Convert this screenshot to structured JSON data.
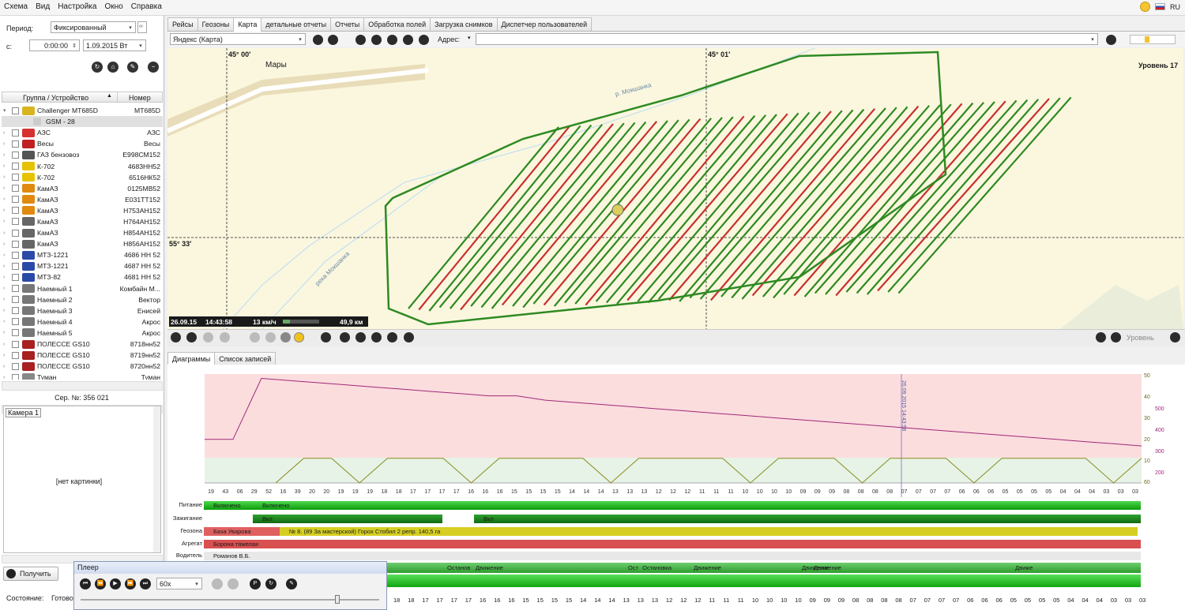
{
  "menu": {
    "items": [
      "Схема",
      "Вид",
      "Настройка",
      "Окно",
      "Справка"
    ],
    "lang": "RU"
  },
  "left": {
    "period_label": "Период:",
    "period_value": "Фиксированный",
    "from_label": "с:",
    "time_value": "0:00:00",
    "date_value": "1.09.2015 Вт",
    "col_group": "Группа / Устройство",
    "col_number": "Номер",
    "devices": [
      {
        "name": "Challenger MT685D",
        "num": "MT685D",
        "color": "#d8b520",
        "expanded": true
      },
      {
        "name": "GSM - 28",
        "num": "",
        "sub": true
      },
      {
        "name": "АЗС",
        "num": "АЗС",
        "color": "#d63030"
      },
      {
        "name": "Весы",
        "num": "Весы",
        "color": "#c02020"
      },
      {
        "name": "ГАЗ бензовоз",
        "num": "Е998СМ152",
        "color": "#555"
      },
      {
        "name": "К-702",
        "num": "4683НН52",
        "color": "#e6c200"
      },
      {
        "name": "К-702",
        "num": "6516НК52",
        "color": "#e6c200"
      },
      {
        "name": "КамАЗ",
        "num": "0125МВ52",
        "color": "#e08a10"
      },
      {
        "name": "КамАЗ",
        "num": "Е031ТТ152",
        "color": "#e08a10"
      },
      {
        "name": "КамАЗ",
        "num": "Н753АН152",
        "color": "#e08a10"
      },
      {
        "name": "КамАЗ",
        "num": "Н764АН152",
        "color": "#666"
      },
      {
        "name": "КамАЗ",
        "num": "Н854АН152",
        "color": "#666"
      },
      {
        "name": "КамАЗ",
        "num": "Н856АН152",
        "color": "#666"
      },
      {
        "name": "МТЗ-1221",
        "num": "4686 НН 52",
        "color": "#2a4aa8"
      },
      {
        "name": "МТЗ-1221",
        "num": "4687 НН 52",
        "color": "#2a4aa8"
      },
      {
        "name": "МТЗ-82",
        "num": "4681 НН 52",
        "color": "#2a4aa8"
      },
      {
        "name": "Наемный 1",
        "num": "Комбайн М...",
        "color": "#777"
      },
      {
        "name": "Наемный 2",
        "num": "Вектор",
        "color": "#777"
      },
      {
        "name": "Наемный 3",
        "num": "Енисей",
        "color": "#777"
      },
      {
        "name": "Наемный 4",
        "num": "Акрос",
        "color": "#777"
      },
      {
        "name": "Наемный 5",
        "num": "Акрос",
        "color": "#777"
      },
      {
        "name": "ПОЛЕССЕ GS10",
        "num": "8718нн52",
        "color": "#a82020"
      },
      {
        "name": "ПОЛЕССЕ GS10",
        "num": "8719нн52",
        "color": "#a82020"
      },
      {
        "name": "ПОЛЕССЕ GS10",
        "num": "8720нн52",
        "color": "#a82020"
      },
      {
        "name": "Туман",
        "num": "Туман",
        "color": "#888"
      }
    ],
    "serial": "Сер. №: 356 021",
    "camera_tab": "Камера 1",
    "no_picture": "[нет картинки]",
    "get_button": "Получить",
    "state_label": "Состояние:",
    "state_value": "Готово"
  },
  "tabs": [
    "Рейсы",
    "Геозоны",
    "Карта",
    "детальные отчеты",
    "Отчеты",
    "Обработка полей",
    "Загрузка снимков",
    "Диспетчер пользователей"
  ],
  "active_tab": "Карта",
  "maptoolbar": {
    "map_source": "Яндекс (Карта)",
    "address_label": "Адрес:"
  },
  "map": {
    "lon1": "45° 00′",
    "lon2": "45° 01′",
    "lat": "55° 33′",
    "level": "Уровень 17",
    "place": "Мары",
    "river1": "р. Мокшанка",
    "river2": "река Мокшанка",
    "status_date": "26.09.15",
    "status_time": "14:43:58",
    "status_speed": "13 км/ч",
    "status_dist": "49,9 км"
  },
  "maptoolbar2": {
    "level_label": "Уровень"
  },
  "bottom_tabs": [
    "Диаграммы",
    "Список записей"
  ],
  "chart_data": {
    "type": "line",
    "x_ticks": [
      "19",
      "43",
      "06",
      "29",
      "52",
      "16",
      "39",
      "20",
      "20",
      "19",
      "19",
      "19",
      "18",
      "18",
      "17",
      "17",
      "17",
      "17",
      "16",
      "16",
      "16",
      "15",
      "15",
      "15",
      "15",
      "14",
      "14",
      "14",
      "13",
      "13",
      "13",
      "12",
      "12",
      "12",
      "11",
      "11",
      "11",
      "10",
      "10",
      "10",
      "10",
      "09",
      "09",
      "09",
      "08",
      "08",
      "08",
      "08",
      "07",
      "07",
      "07",
      "07",
      "06",
      "06",
      "06",
      "05",
      "05",
      "05",
      "05",
      "04",
      "04",
      "04",
      "03",
      "03",
      "03"
    ],
    "y_right_labels": [
      "50",
      "40",
      "30",
      "20",
      "10",
      "60"
    ],
    "y_right2_labels": [
      "500",
      "400",
      "300",
      "200"
    ],
    "cursor_label": "26.09.2015 14:43:58",
    "series": [
      {
        "values": [
          200,
          200,
          480,
          470,
          460,
          450,
          440,
          430,
          420,
          410,
          400,
          400,
          380,
          370,
          360,
          350,
          340,
          330,
          320,
          310,
          300,
          290,
          280,
          270,
          260,
          250,
          240,
          230,
          220,
          210,
          200,
          190,
          180,
          170
        ]
      },
      {
        "values": [
          0,
          12,
          12,
          0,
          12,
          12,
          12,
          0,
          12,
          12,
          12,
          12,
          0,
          12,
          12,
          12,
          12,
          0,
          12,
          12,
          12,
          0,
          12,
          12,
          12,
          0,
          12,
          12,
          12,
          12,
          0,
          12
        ]
      }
    ]
  },
  "timeline": {
    "rows": [
      {
        "label": "Питание",
        "segments": [
          {
            "text": "Включено"
          },
          {
            "text": "Включено"
          }
        ]
      },
      {
        "label": "Зажигание",
        "segments": [
          {
            "text": "Вкл"
          },
          {
            "text": "Вкл"
          }
        ]
      },
      {
        "label": "Геозона",
        "segments": [
          {
            "text": "База Уварова"
          },
          {
            "text": "№ 8. (89 За мастерской) Горох Стобил 2 репр. 140,5 га"
          }
        ]
      },
      {
        "label": "Агрегат",
        "segments": [
          {
            "text": "Борона тяжелая"
          }
        ]
      },
      {
        "label": "Водитель",
        "segments": [
          {
            "text": "Романов В.Б."
          }
        ]
      }
    ],
    "move_row": [
      "Останов",
      "Движение",
      "Ост",
      "Остановка",
      "Движение",
      "Движение",
      "Движение",
      "Движе"
    ],
    "bottom_ticks": [
      "18",
      "18",
      "17",
      "17",
      "17",
      "17",
      "16",
      "16",
      "16",
      "15",
      "15",
      "15",
      "15",
      "14",
      "14",
      "14",
      "13",
      "13",
      "13",
      "12",
      "12",
      "12",
      "11",
      "11",
      "11",
      "10",
      "10",
      "10",
      "10",
      "09",
      "09",
      "09",
      "08",
      "08",
      "08",
      "08",
      "07",
      "07",
      "07",
      "07",
      "06",
      "06",
      "06",
      "05",
      "05",
      "05",
      "05",
      "04",
      "04",
      "04",
      "03",
      "03",
      "03"
    ]
  },
  "player": {
    "title": "Плеер",
    "speed": "60х"
  }
}
